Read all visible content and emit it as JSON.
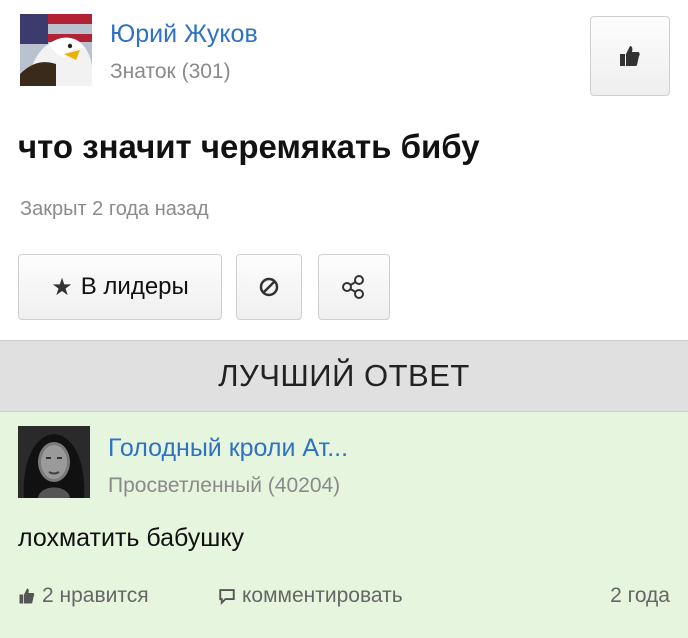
{
  "question": {
    "author_name": "Юрий Жуков",
    "author_rank": "Знаток (301)",
    "title": "что значит черемякать бибу",
    "status": "Закрыт 2 года назад",
    "leaders_button": "В лидеры",
    "icons": [
      "thumbs-up-icon",
      "star-icon",
      "block-icon",
      "share-icon"
    ]
  },
  "best_answer": {
    "header": "ЛУЧШИЙ ОТВЕТ",
    "author_name": "Голодный кроли Ат...",
    "author_rank": "Просветленный (40204)",
    "text": "лохматить бабушку",
    "likes": "2 нравится",
    "comment": "комментировать",
    "time": "2 года"
  },
  "colors": {
    "link": "#2f72c4",
    "muted": "#8a8a8a",
    "answer_bg": "#e6f5de",
    "best_bar_bg": "#e0e0e0"
  }
}
